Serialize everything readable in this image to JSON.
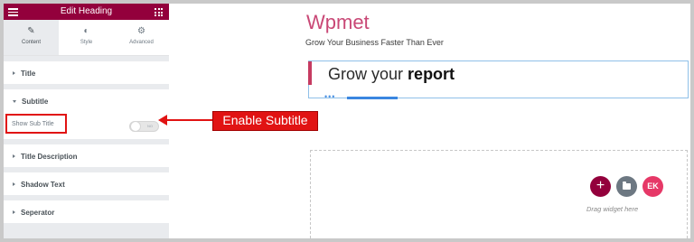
{
  "panel": {
    "header_title": "Edit Heading",
    "tabs": [
      {
        "label": "Content",
        "icon": "pencil-icon",
        "active": true
      },
      {
        "label": "Style",
        "icon": "half-circle-icon",
        "active": false
      },
      {
        "label": "Advanced",
        "icon": "gear-icon",
        "active": false
      }
    ],
    "sections": {
      "title": "Title",
      "subtitle": "Subtitle",
      "title_description": "Title Description",
      "shadow_text": "Shadow Text",
      "separator": "Seperator"
    },
    "show_sub_title": {
      "label": "Show Sub Title",
      "toggle_text": "NO",
      "enabled": false
    }
  },
  "annotation": {
    "callout": "Enable Subtitle",
    "color": "#e11313"
  },
  "preview": {
    "brand": "Wpmet",
    "tagline": "Grow Your Business Faster Than Ever",
    "heading_plain": "Grow your",
    "heading_bold": "report",
    "drop_label": "Drag widget here",
    "add_symbol": "+",
    "ek_label": "EK"
  },
  "colors": {
    "brand": "#93003c",
    "accent": "#c94876",
    "separator": "#3a86e0"
  }
}
